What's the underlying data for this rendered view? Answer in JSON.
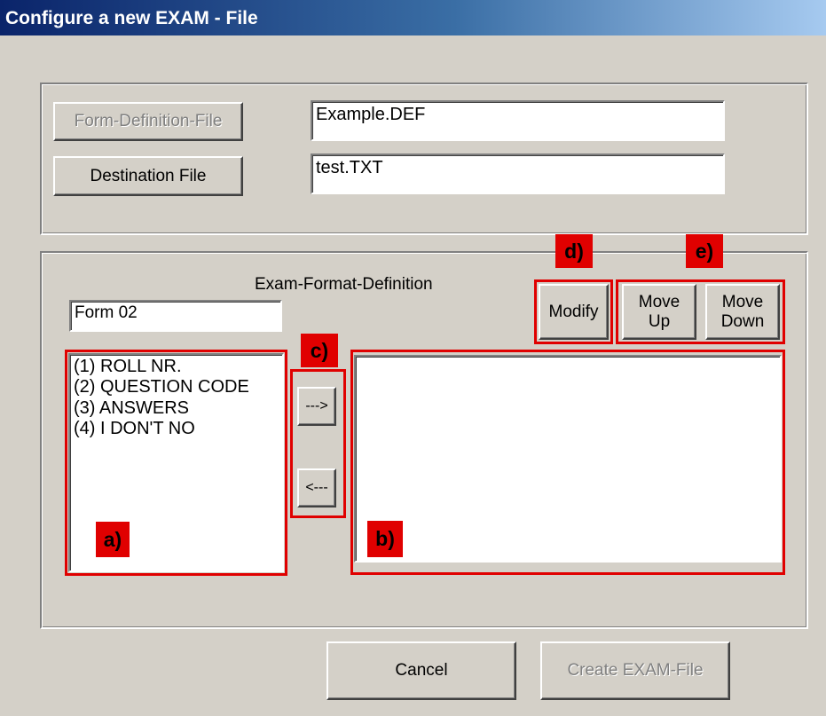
{
  "window": {
    "title": "Configure a new EXAM - File"
  },
  "files": {
    "form_definition_button": "Form-Definition-File",
    "form_definition_value": "Example.DEF",
    "destination_button": "Destination File",
    "destination_value": "test.TXT"
  },
  "exam_format": {
    "heading": "Exam-Format-Definition",
    "form_name": "Form 02",
    "available_items": [
      "(1) ROLL NR.",
      "(2) QUESTION CODE",
      "(3) ANSWERS",
      "(4) I DON'T NO"
    ],
    "selected_items": [],
    "add_button": "--->",
    "remove_button": "<---",
    "modify_button": "Modify",
    "move_up_line1": "Move",
    "move_up_line2": "Up",
    "move_down_line1": "Move",
    "move_down_line2": "Down"
  },
  "annotations": {
    "a": "a)",
    "b": "b)",
    "c": "c)",
    "d": "d)",
    "e": "e)"
  },
  "footer": {
    "cancel_button": "Cancel",
    "create_button": "Create EXAM-File"
  },
  "colors": {
    "annotation_red": "#e00000",
    "title_bar": "#0a246a",
    "dialog_bg": "#d4d0c8"
  }
}
